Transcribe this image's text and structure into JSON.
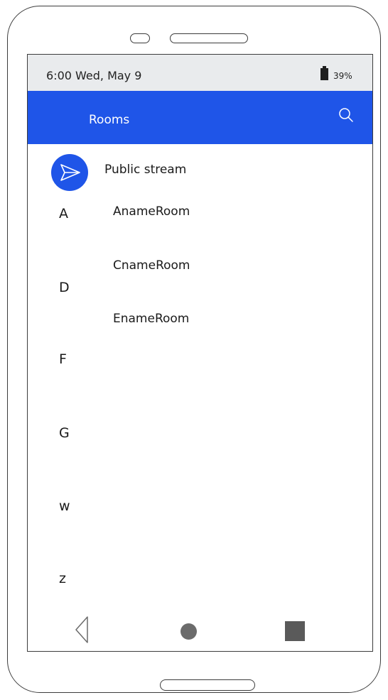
{
  "status_bar": {
    "time_date": "6:00  Wed, May 9",
    "battery": "39%"
  },
  "app_bar": {
    "title": "Rooms"
  },
  "public_stream": {
    "label": "Public stream"
  },
  "rooms": [
    "AnameRoom",
    "CnameRoom",
    "EnameRoom"
  ],
  "index_letters": [
    "A",
    "D",
    "F",
    "G",
    "w",
    "z"
  ],
  "colors": {
    "accent": "#1f55e8",
    "status_bar_bg": "#e9ebed"
  }
}
